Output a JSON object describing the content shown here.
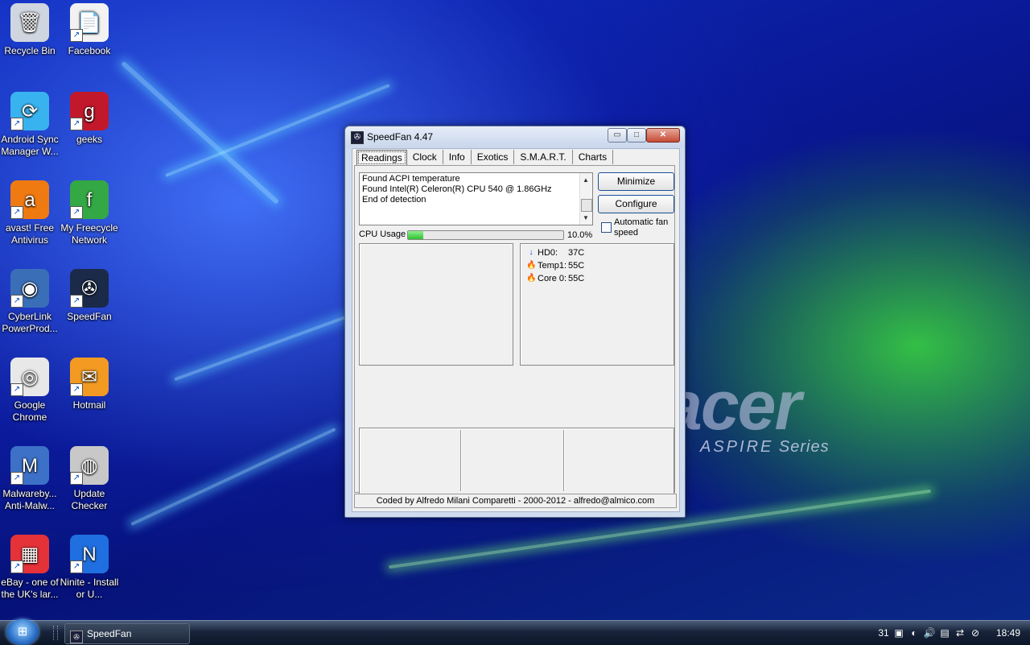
{
  "desktop": {
    "icons": [
      {
        "label": "Recycle Bin",
        "glyph": "🗑",
        "bg": "#cfd6df"
      },
      {
        "label": "Facebook",
        "glyph": "📄",
        "bg": "#f2f2f2"
      },
      {
        "label": "Android Sync Manager W...",
        "glyph": "⟳",
        "bg": "#39b3ef"
      },
      {
        "label": "geeks",
        "glyph": "g",
        "bg": "#c2182b"
      },
      {
        "label": "avast! Free Antivirus",
        "glyph": "a",
        "bg": "#f07a12"
      },
      {
        "label": "My Freecycle Network",
        "glyph": "f",
        "bg": "#34a844"
      },
      {
        "label": "CyberLink PowerProd...",
        "glyph": "◉",
        "bg": "#3a6fb8"
      },
      {
        "label": "SpeedFan",
        "glyph": "✇",
        "bg": "#1a2a48"
      },
      {
        "label": "Google Chrome",
        "glyph": "◎",
        "bg": "#e8e8e8"
      },
      {
        "label": "Hotmail",
        "glyph": "✉",
        "bg": "#f39a22"
      },
      {
        "label": "Malwareby... Anti-Malw...",
        "glyph": "M",
        "bg": "#3d71c7"
      },
      {
        "label": "Update Checker",
        "glyph": "◍",
        "bg": "#c8c8c8"
      },
      {
        "label": "eBay - one of the UK's lar...",
        "glyph": "▦",
        "bg": "#e53238"
      },
      {
        "label": "Ninite - Install or U...",
        "glyph": "N",
        "bg": "#1f6fe0"
      }
    ],
    "wallpaper": {
      "logo": "acer",
      "series_word": "ASPIRE",
      "series_suffix": "Series"
    }
  },
  "window": {
    "title": "SpeedFan 4.47",
    "controls": {
      "minimize": "▭",
      "maximize": "□",
      "close": "✕"
    },
    "tabs": [
      "Readings",
      "Clock",
      "Info",
      "Exotics",
      "S.M.A.R.T.",
      "Charts"
    ],
    "log_lines": [
      "Found ACPI temperature",
      "Found Intel(R) Celeron(R) CPU 540 @ 1.86GHz",
      "End of detection"
    ],
    "buttons": {
      "minimize": "Minimize",
      "configure": "Configure"
    },
    "auto_fan_label": "Automatic fan speed",
    "auto_fan_checked": false,
    "cpu_usage_label": "CPU Usage",
    "cpu_usage_value": "10.0%",
    "cpu_usage_fraction": 0.1,
    "readings": [
      {
        "icon": "arrow-down-icon",
        "glyph": "↓",
        "color": "#1a35c8",
        "name": "HD0:",
        "value": "37C"
      },
      {
        "icon": "flame-icon",
        "glyph": "🔥",
        "color": "#e04a10",
        "name": "Temp1:",
        "value": "55C"
      },
      {
        "icon": "flame-icon",
        "glyph": "🔥",
        "color": "#e04a10",
        "name": "Core 0:",
        "value": "55C"
      }
    ],
    "status": "Coded by Alfredo Milani Comparetti - 2000-2012 - alfredo@almico.com"
  },
  "taskbar": {
    "start_glyph": "⊞",
    "task_label": "SpeedFan",
    "tray_icons": [
      "31",
      "▣",
      "◐",
      "🔊",
      "▤",
      "⇄",
      "⊘"
    ],
    "clock": "18:49"
  }
}
